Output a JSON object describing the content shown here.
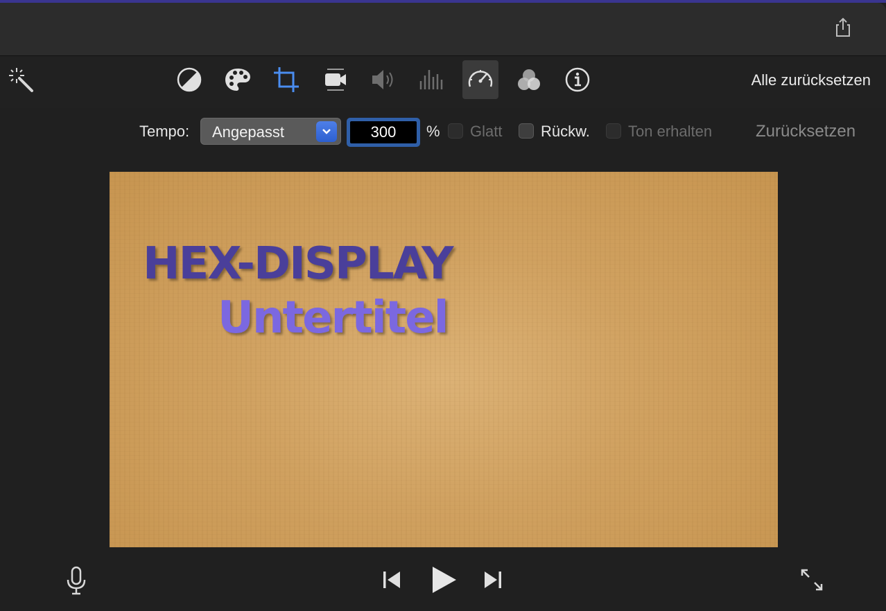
{
  "window": {
    "share_icon": "share-icon"
  },
  "toolbar": {
    "tools": [
      {
        "name": "magic-wand-icon"
      },
      {
        "name": "color-balance-icon"
      },
      {
        "name": "color-palette-icon"
      },
      {
        "name": "crop-icon"
      },
      {
        "name": "stabilization-icon"
      },
      {
        "name": "volume-icon"
      },
      {
        "name": "equalizer-icon"
      },
      {
        "name": "speed-icon",
        "active": true
      },
      {
        "name": "clip-filter-icon"
      },
      {
        "name": "info-icon"
      }
    ],
    "reset_all_label": "Alle zurücksetzen",
    "accent": "#4a8df0"
  },
  "speed": {
    "tempo_label": "Tempo:",
    "mode_value": "Angepasst",
    "percent_value": "300",
    "percent_symbol": "%",
    "smooth_label": "Glatt",
    "reverse_label": "Rückw.",
    "preserve_pitch_label": "Ton erhalten",
    "reset_label": "Zurücksetzen"
  },
  "viewer": {
    "title_text": "HEX-DISPLAY",
    "subtitle_text": "Untertitel"
  },
  "playback": {
    "mic_icon": "microphone-icon",
    "prev_icon": "skip-back-icon",
    "play_icon": "play-icon",
    "next_icon": "skip-forward-icon",
    "fullscreen_icon": "fullscreen-icon"
  }
}
